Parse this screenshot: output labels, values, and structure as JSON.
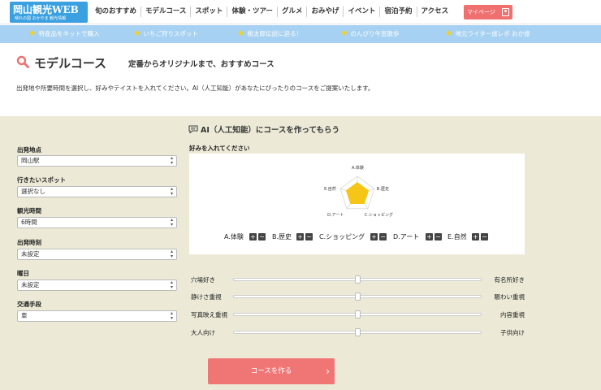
{
  "header": {
    "logo_main": "岡山観光WEB",
    "logo_sub": "晴れの国 おかやま 観光情報",
    "nav": [
      "旬のおすすめ",
      "モデルコース",
      "スポット",
      "体験・ツアー",
      "グルメ",
      "おみやげ",
      "イベント",
      "宿泊予約",
      "アクセス"
    ],
    "mypage_label": "マイページ"
  },
  "bluebar": {
    "items": [
      "特産品をネットで購入",
      "いちご狩りスポット",
      "桃太郎伝説に迫る！",
      "のんびり牛窓散歩",
      "地元ライター旅レポ おか旅"
    ]
  },
  "title": {
    "main": "モデルコース",
    "sub": "定番からオリジナルまで、おすすめコース"
  },
  "lead": "出発地や所要時間を選択し、好みやテイストを入れてください。AI（人工知能）があなたにぴったりのコースをご提案いたします。",
  "form": {
    "fields": [
      {
        "label": "出発地点",
        "value": "岡山駅"
      },
      {
        "label": "行きたいスポット",
        "value": "選択なし"
      },
      {
        "label": "観光時間",
        "value": "6時間"
      },
      {
        "label": "出発時刻",
        "value": "未設定"
      },
      {
        "label": "曜日",
        "value": "未設定"
      },
      {
        "label": "交通手段",
        "value": "車"
      }
    ]
  },
  "ai": {
    "title": "AI（人工知能）にコースを作ってもらう",
    "pref_label": "好みを入れてください",
    "axes": [
      "A.体験",
      "B.歴史",
      "C.ショッピング",
      "D.アート",
      "E.自然"
    ],
    "axis_values": [
      0.5,
      0.5,
      0.5,
      0.5,
      0.5
    ],
    "fill_color": "#f5c518",
    "plus": "+",
    "minus": "−"
  },
  "sliders": [
    {
      "left": "穴場好き",
      "right": "有名所好き",
      "value": 0.5
    },
    {
      "left": "静けさ重視",
      "right": "賑わい重視",
      "value": 0.5
    },
    {
      "left": "写真映え重視",
      "right": "内容重視",
      "value": 0.5
    },
    {
      "left": "大人向け",
      "right": "子供向け",
      "value": 0.5
    }
  ],
  "cta": {
    "label": "コースを作る",
    "arrow": "›"
  },
  "colors": {
    "accent": "#f07676",
    "blue": "#a6d1f2",
    "panel": "#ecead7"
  }
}
